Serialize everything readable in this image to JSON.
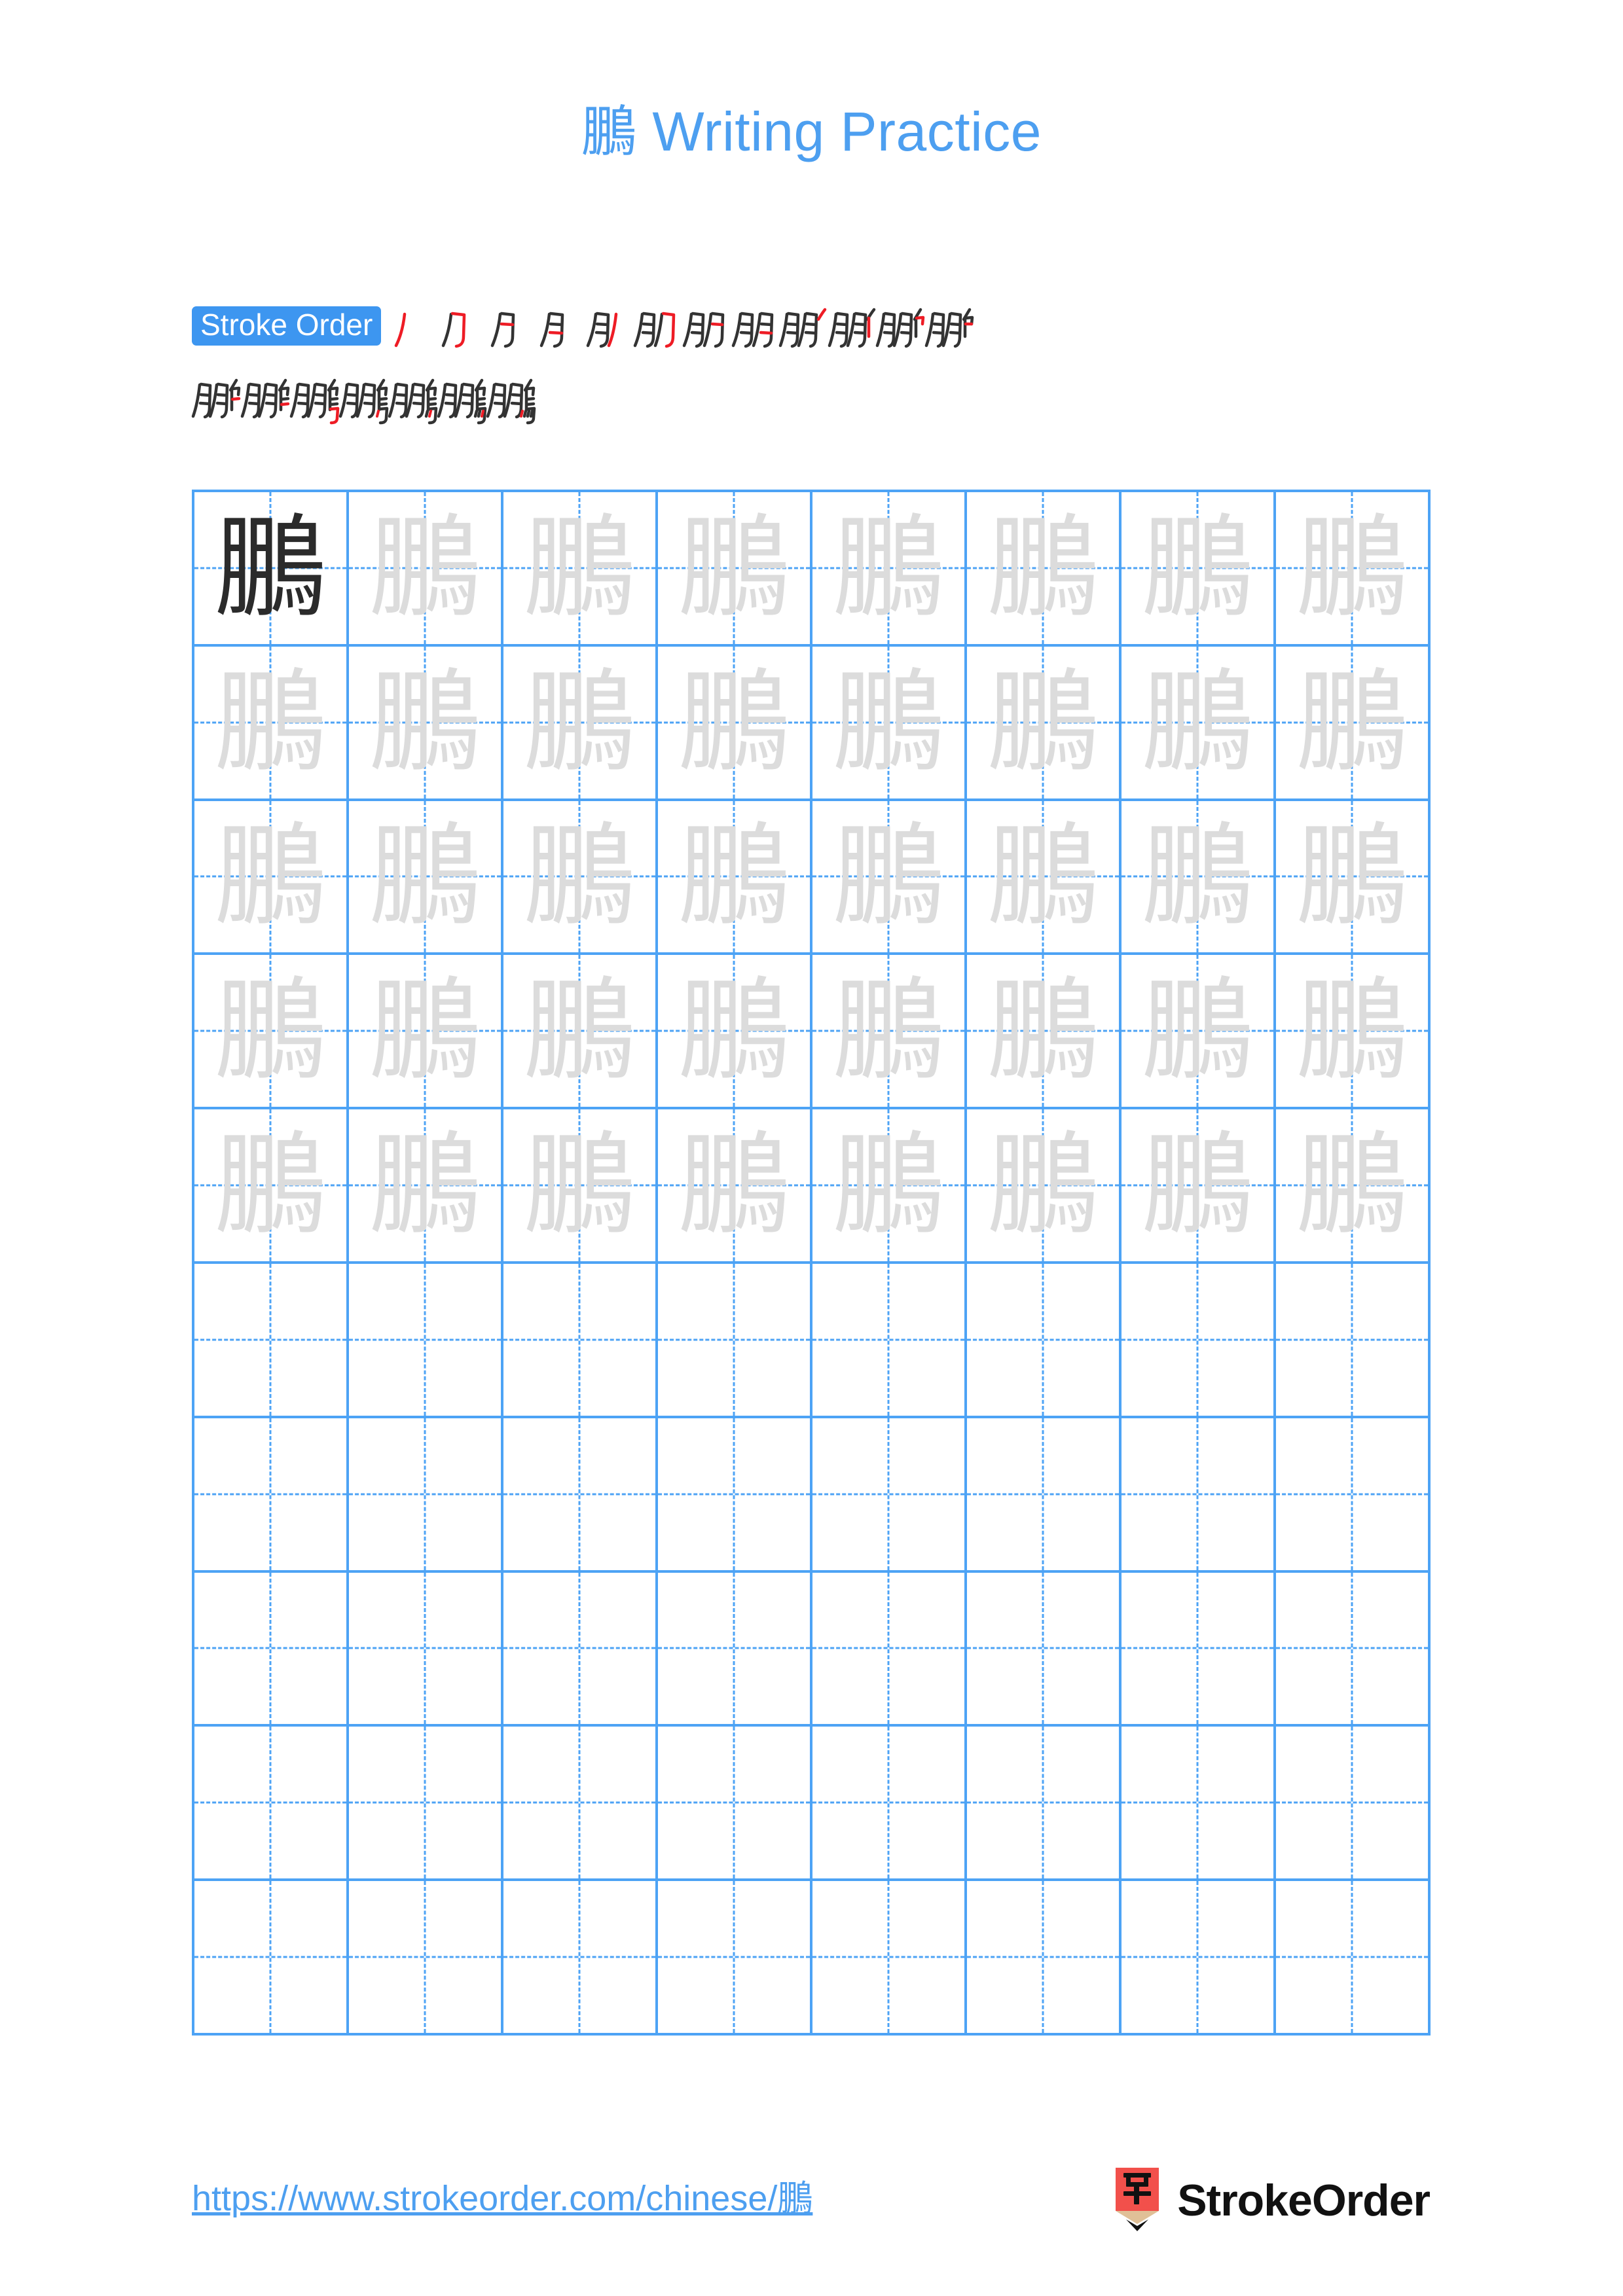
{
  "page": {
    "character": "鵬",
    "title_suffix": "Writing Practice",
    "title_full": "鵬 Writing Practice",
    "accent_blue": "#4D9FF0",
    "grid_blue": "#4DA3F5",
    "badge_blue": "#3D96F0",
    "trace_gray": "#DCDCDC",
    "dark_ink": "#2B2B2B",
    "stroke_new_red": "#EE1C25",
    "logo_red": "#F2504B",
    "logo_wood": "#E0C097"
  },
  "stroke_order": {
    "badge_label": "Stroke Order",
    "total_strokes": 19,
    "row1_count": 12,
    "row2_count": 7,
    "steps": [
      {
        "index": 1,
        "partial": "丿"
      },
      {
        "index": 2,
        "partial": "刀"
      },
      {
        "index": 3,
        "partial": "月"
      },
      {
        "index": 4,
        "partial": "月"
      },
      {
        "index": 5,
        "partial": "月丿"
      },
      {
        "index": 6,
        "partial": "朋"
      },
      {
        "index": 7,
        "partial": "朋"
      },
      {
        "index": 8,
        "partial": "朋"
      },
      {
        "index": 9,
        "partial": "朋丶"
      },
      {
        "index": 10,
        "partial": "朋丿"
      },
      {
        "index": 11,
        "partial": "朋𠂊"
      },
      {
        "index": 12,
        "partial": "腗"
      },
      {
        "index": 13,
        "partial": "腗"
      },
      {
        "index": 14,
        "partial": "腗"
      },
      {
        "index": 15,
        "partial": "鵬"
      },
      {
        "index": 16,
        "partial": "鵬"
      },
      {
        "index": 17,
        "partial": "鵬"
      },
      {
        "index": 18,
        "partial": "鵬"
      },
      {
        "index": 19,
        "partial": "鵬"
      }
    ]
  },
  "practice_grid": {
    "columns": 8,
    "rows": 10,
    "traced_rows": 5,
    "blank_rows": 5,
    "model_cell_index": 0,
    "cell_character": "鵬"
  },
  "footer": {
    "url": "https://www.strokeorder.com/chinese/鵬",
    "brand_name": "StrokeOrder",
    "logo_character": "字"
  }
}
